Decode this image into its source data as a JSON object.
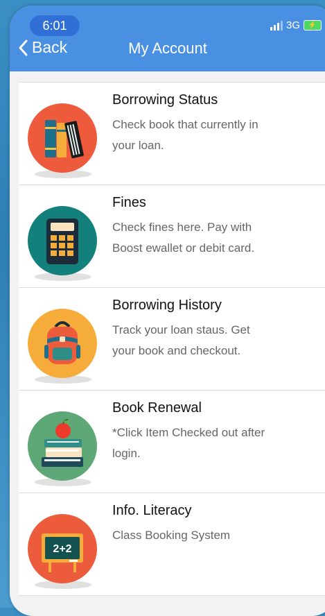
{
  "status_bar": {
    "time": "6:01",
    "network": "3G"
  },
  "nav": {
    "back_label": "Back",
    "title": "My Account"
  },
  "items": [
    {
      "title": "Borrowing Status",
      "desc_lines": [
        "Check book that currently in",
        "your loan."
      ],
      "icon": "books-icon",
      "color": "#ee5a3c"
    },
    {
      "title": "Fines",
      "desc_lines": [
        "Check fines here. Pay with",
        "Boost ewallet or debit card."
      ],
      "icon": "calculator-icon",
      "color": "#14807c"
    },
    {
      "title": "Borrowing History",
      "desc_lines": [
        "Track your loan staus. Get",
        "your book and checkout."
      ],
      "icon": "backpack-icon",
      "color": "#f6ac3b"
    },
    {
      "title": "Book Renewal",
      "desc_lines": [
        "*Click Item Checked out after",
        "login."
      ],
      "icon": "apple-books-icon",
      "color": "#5ea878"
    },
    {
      "title": "Info. Literacy",
      "desc_lines": [
        "Class Booking System"
      ],
      "icon": "chalkboard-icon",
      "color": "#ec5c3c"
    }
  ],
  "colors": {
    "nav_blue": "#4a90e2",
    "time_pill": "#2f6fd6",
    "battery_green": "#4cd964"
  }
}
